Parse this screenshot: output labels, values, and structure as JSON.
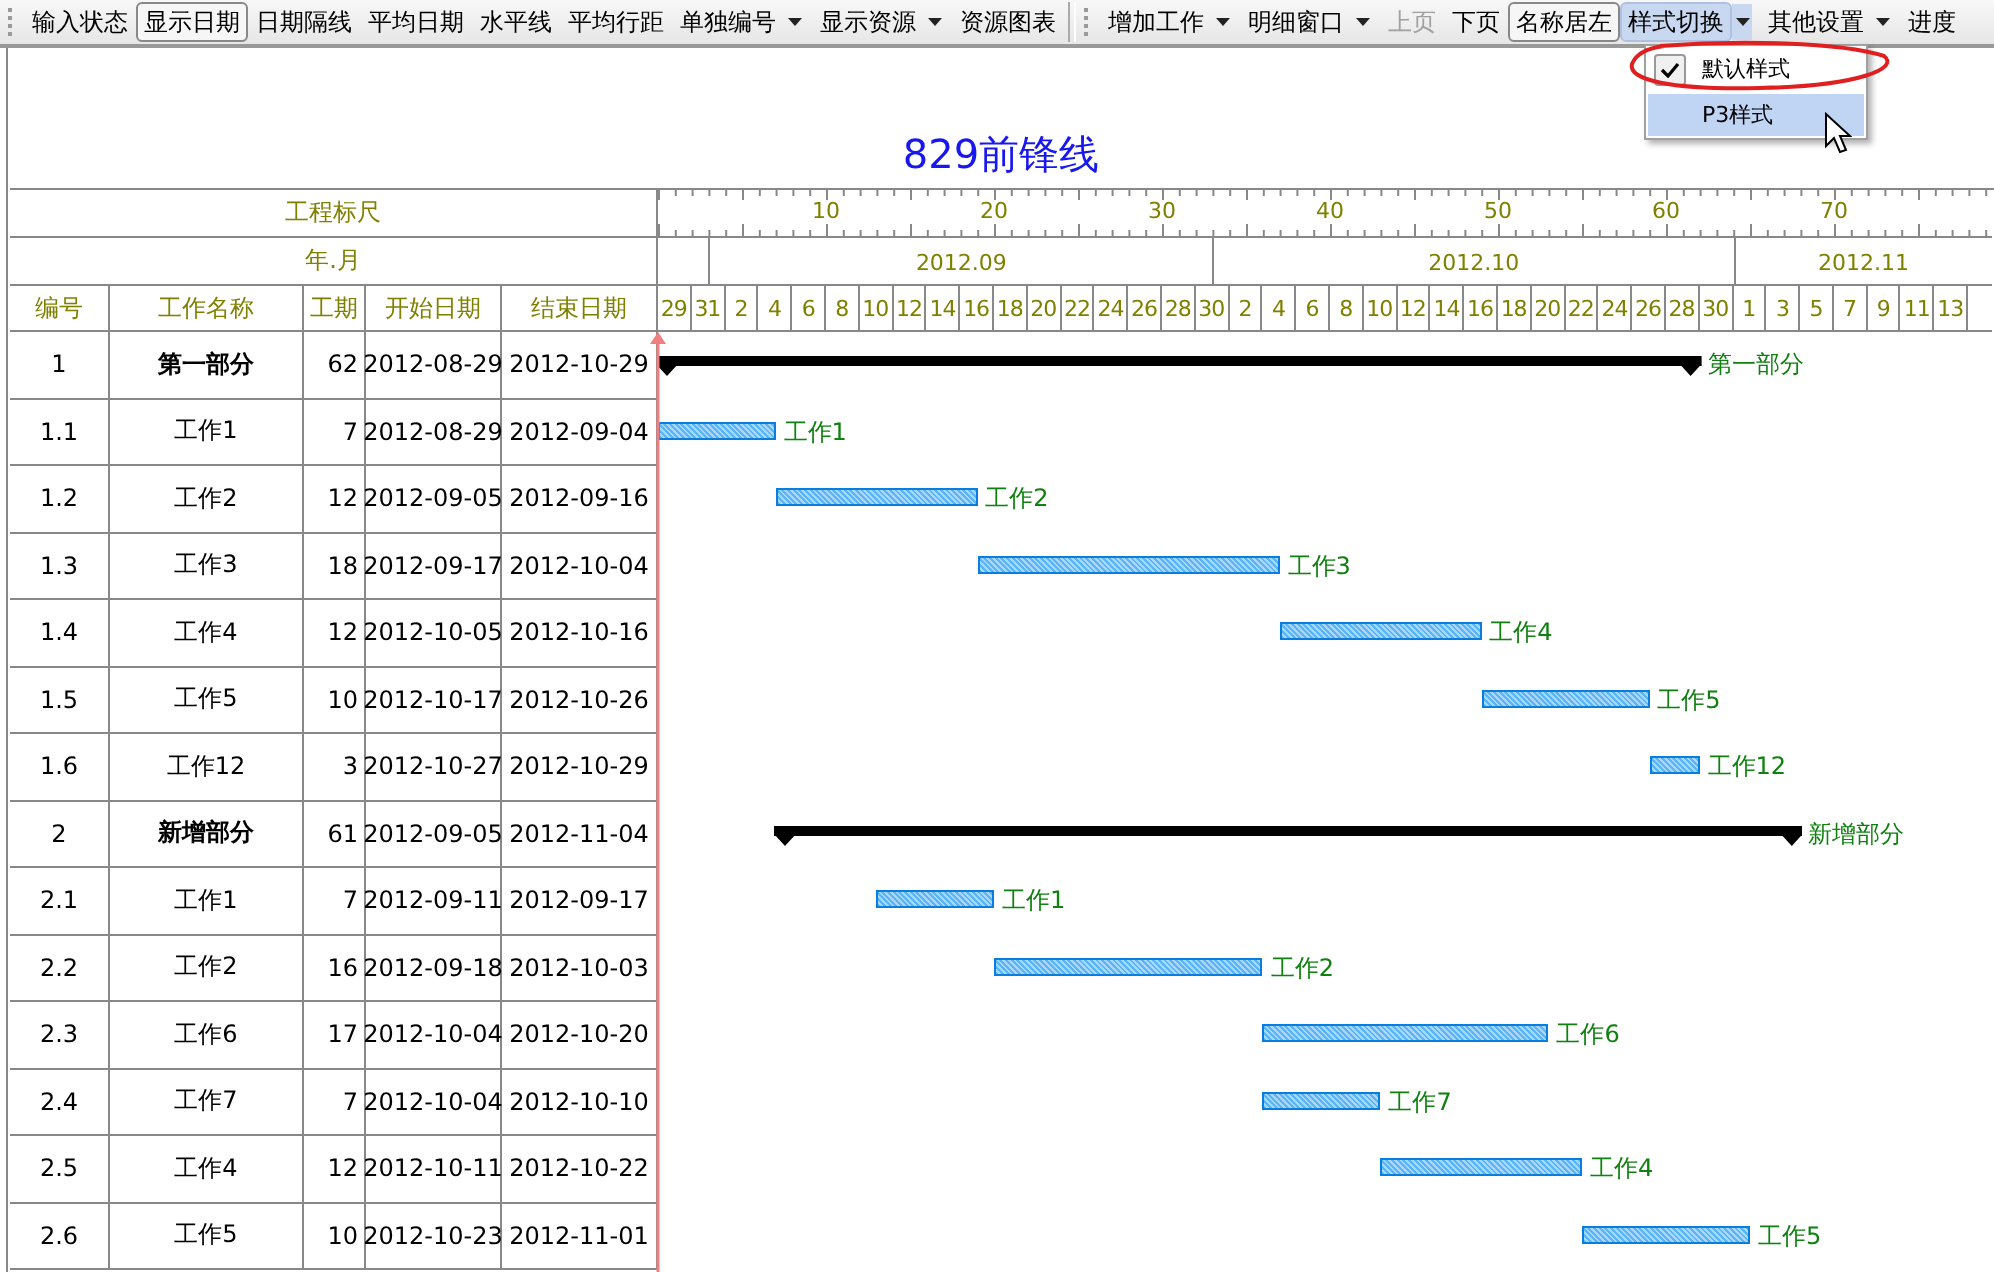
{
  "toolbar": {
    "groups": [
      {
        "items": [
          {
            "label": "输入状态",
            "pressed": false,
            "dropdown": false,
            "disabled": false
          },
          {
            "label": "显示日期",
            "pressed": true,
            "dropdown": false,
            "disabled": false
          },
          {
            "label": "日期隔线",
            "pressed": false,
            "dropdown": false,
            "disabled": false
          },
          {
            "label": "平均日期",
            "pressed": false,
            "dropdown": false,
            "disabled": false
          },
          {
            "label": "水平线",
            "pressed": false,
            "dropdown": false,
            "disabled": false
          },
          {
            "label": "平均行距",
            "pressed": false,
            "dropdown": false,
            "disabled": false
          },
          {
            "label": "单独编号",
            "pressed": false,
            "dropdown": true,
            "disabled": false
          },
          {
            "label": "显示资源",
            "pressed": false,
            "dropdown": true,
            "disabled": false
          },
          {
            "label": "资源图表",
            "pressed": false,
            "dropdown": false,
            "disabled": false
          }
        ]
      },
      {
        "items": [
          {
            "label": "增加工作",
            "pressed": false,
            "dropdown": true,
            "disabled": false
          },
          {
            "label": "明细窗口",
            "pressed": false,
            "dropdown": true,
            "disabled": false
          },
          {
            "label": "上页",
            "pressed": false,
            "dropdown": false,
            "disabled": true
          },
          {
            "label": "下页",
            "pressed": false,
            "dropdown": false,
            "disabled": false
          },
          {
            "label": "名称居左",
            "pressed": true,
            "dropdown": false,
            "disabled": false
          },
          {
            "label": "样式切换",
            "pressed": false,
            "dropdown": true,
            "disabled": false,
            "open": true
          },
          {
            "label": "其他设置",
            "pressed": false,
            "dropdown": true,
            "disabled": false
          },
          {
            "label": "进度",
            "pressed": false,
            "dropdown": false,
            "disabled": false
          }
        ]
      }
    ]
  },
  "menu": {
    "items": [
      {
        "label": "默认样式",
        "checked": true,
        "selected": false
      },
      {
        "label": "P3样式",
        "checked": false,
        "selected": true
      }
    ]
  },
  "title": "829前锋线",
  "header": {
    "ruler_label": "工程标尺",
    "month_label": "年.月",
    "ruler_ticks": [
      "10",
      "20",
      "30",
      "40",
      "50",
      "60",
      "70"
    ],
    "months": [
      "2012.09",
      "2012.10",
      "2012.11"
    ],
    "columns": [
      "编号",
      "工作名称",
      "工期",
      "开始日期",
      "结束日期"
    ],
    "days": [
      "29",
      "31",
      "2",
      "4",
      "6",
      "8",
      "10",
      "12",
      "14",
      "16",
      "18",
      "20",
      "22",
      "24",
      "26",
      "28",
      "30",
      "2",
      "4",
      "6",
      "8",
      "10",
      "12",
      "14",
      "16",
      "18",
      "20",
      "22",
      "24",
      "26",
      "28",
      "30",
      "1",
      "3",
      "5",
      "7",
      "9",
      "11",
      "13"
    ]
  },
  "rows": [
    {
      "id": "1",
      "name": "第一部分",
      "duration": "62",
      "start": "2012-08-29",
      "end": "2012-10-29",
      "kind": "summary",
      "bar_label": "第一部分"
    },
    {
      "id": "1.1",
      "name": "工作1",
      "duration": "7",
      "start": "2012-08-29",
      "end": "2012-09-04",
      "kind": "task",
      "bar_label": "工作1"
    },
    {
      "id": "1.2",
      "name": "工作2",
      "duration": "12",
      "start": "2012-09-05",
      "end": "2012-09-16",
      "kind": "task",
      "bar_label": "工作2"
    },
    {
      "id": "1.3",
      "name": "工作3",
      "duration": "18",
      "start": "2012-09-17",
      "end": "2012-10-04",
      "kind": "task",
      "bar_label": "工作3"
    },
    {
      "id": "1.4",
      "name": "工作4",
      "duration": "12",
      "start": "2012-10-05",
      "end": "2012-10-16",
      "kind": "task",
      "bar_label": "工作4"
    },
    {
      "id": "1.5",
      "name": "工作5",
      "duration": "10",
      "start": "2012-10-17",
      "end": "2012-10-26",
      "kind": "task",
      "bar_label": "工作5"
    },
    {
      "id": "1.6",
      "name": "工作12",
      "duration": "3",
      "start": "2012-10-27",
      "end": "2012-10-29",
      "kind": "task",
      "bar_label": "工作12"
    },
    {
      "id": "2",
      "name": "新增部分",
      "duration": "61",
      "start": "2012-09-05",
      "end": "2012-11-04",
      "kind": "summary",
      "bar_label": "新增部分"
    },
    {
      "id": "2.1",
      "name": "工作1",
      "duration": "7",
      "start": "2012-09-11",
      "end": "2012-09-17",
      "kind": "task",
      "bar_label": "工作1"
    },
    {
      "id": "2.2",
      "name": "工作2",
      "duration": "16",
      "start": "2012-09-18",
      "end": "2012-10-03",
      "kind": "task",
      "bar_label": "工作2"
    },
    {
      "id": "2.3",
      "name": "工作6",
      "duration": "17",
      "start": "2012-10-04",
      "end": "2012-10-20",
      "kind": "task",
      "bar_label": "工作6"
    },
    {
      "id": "2.4",
      "name": "工作7",
      "duration": "7",
      "start": "2012-10-04",
      "end": "2012-10-10",
      "kind": "task",
      "bar_label": "工作7"
    },
    {
      "id": "2.5",
      "name": "工作4",
      "duration": "12",
      "start": "2012-10-11",
      "end": "2012-10-22",
      "kind": "task",
      "bar_label": "工作4"
    },
    {
      "id": "2.6",
      "name": "工作5",
      "duration": "10",
      "start": "2012-10-23",
      "end": "2012-11-01",
      "kind": "task",
      "bar_label": "工作5"
    }
  ]
}
